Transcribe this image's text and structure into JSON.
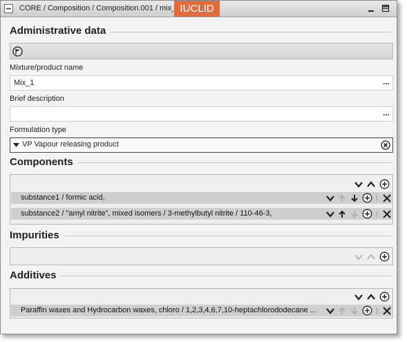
{
  "window": {
    "breadcrumb": "CORE / Composition / Composition.001 / mix_1",
    "brand": "IUCLID"
  },
  "administrative": {
    "title": "Administrative data",
    "mixture_label": "Mixture/product name",
    "mixture_value": "Mix_1",
    "brief_label": "Brief description",
    "brief_value": "",
    "formulation_label": "Formulation type",
    "formulation_value": "VP Vapour releasing product",
    "more_glyph": "..."
  },
  "components": {
    "title": "Components",
    "rows": [
      {
        "text": "substance1 / formic acid,"
      },
      {
        "text": "substance2 / \"amyl nitrite\", mixed isomers / 3-methylbutyl nitrite / 110-46-3,"
      }
    ]
  },
  "impurities": {
    "title": "Impurities",
    "rows": []
  },
  "additives": {
    "title": "Additives",
    "rows": [
      {
        "text": "Paraffin waxes and Hydrocarbon waxes, chloro / 1,2,3,4,6,7,10-heptachlorododecane ..."
      }
    ]
  },
  "colors": {
    "brand": "#e46b3c",
    "row_bg": "#cfcfcf",
    "panel_bg": "#f3f3f3"
  },
  "icons": {
    "collapse": "collapse-icon",
    "minimize": "minimize-icon",
    "maximize": "maximize-icon",
    "flag": "flag-icon",
    "expand_all": "chevron-down-icon",
    "collapse_all": "chevron-up-icon",
    "add": "add-circle-icon",
    "move_up": "arrow-up-icon",
    "move_down": "arrow-down-icon",
    "delete": "close-icon",
    "clear": "clear-circle-icon",
    "dropdown": "triangle-down-icon"
  }
}
